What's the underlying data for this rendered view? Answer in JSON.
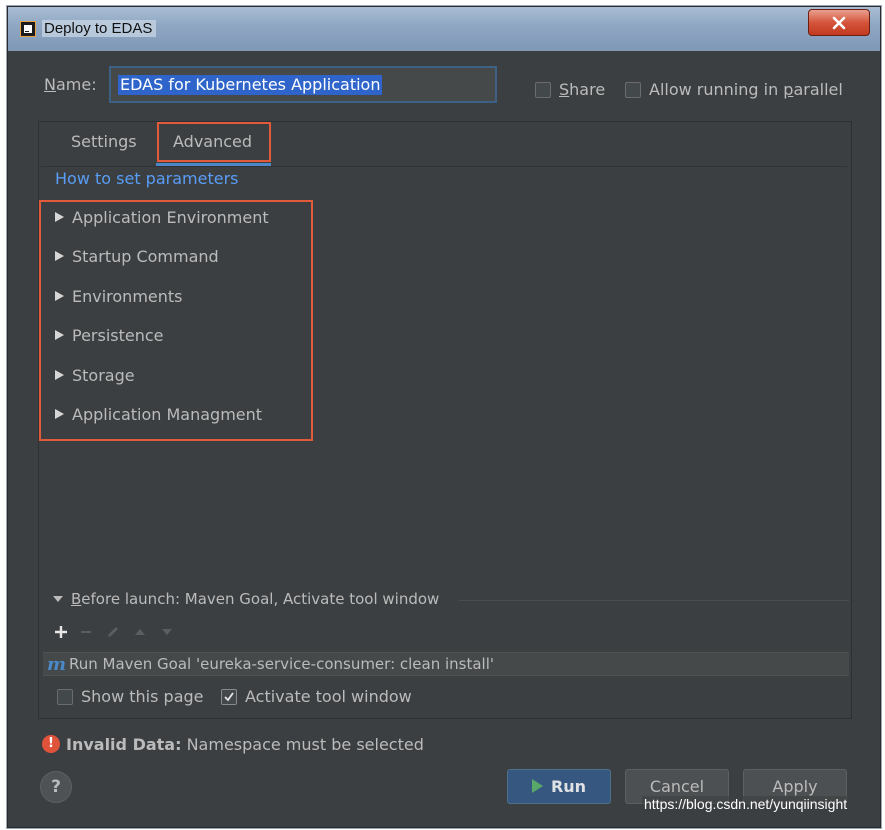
{
  "window": {
    "title": "Deploy to EDAS"
  },
  "form": {
    "name_label_mnemonic": "N",
    "name_label_rest": "ame:",
    "name_value": "EDAS for Kubernetes Application",
    "share_mnemonic": "S",
    "share_rest": "hare",
    "share_checked": false,
    "parallel_prefix": "Allow running in ",
    "parallel_mnemonic": "p",
    "parallel_rest": "arallel",
    "parallel_checked": false
  },
  "tabs": [
    {
      "label": "Settings",
      "active": false
    },
    {
      "label": "Advanced",
      "active": true
    }
  ],
  "help_link": "How to set parameters",
  "sections": [
    "Application Environment",
    "Startup Command",
    "Environments",
    "Persistence",
    "Storage",
    "Application Managment"
  ],
  "before_launch": {
    "mnemonic": "B",
    "rest": "efore launch: Maven Goal, Activate tool window",
    "toolbar_icons": [
      "add-icon",
      "remove-icon",
      "edit-icon",
      "move-up-icon",
      "move-down-icon"
    ],
    "tasks": [
      {
        "icon": "maven-icon",
        "icon_glyph": "m",
        "label": "Run Maven Goal 'eureka-service-consumer: clean install'"
      }
    ],
    "show_page_label": "Show this page",
    "show_page_checked": false,
    "activate_label": "Activate tool window",
    "activate_checked": true
  },
  "warning": {
    "icon": "error-icon",
    "icon_glyph": "!",
    "bold": "Invalid Data:",
    "message": "Namespace must be selected"
  },
  "buttons": {
    "help": "?",
    "run": "Run",
    "cancel": "Cancel",
    "apply": "Apply"
  },
  "watermark": "https://blog.csdn.net/yunqiinsight",
  "colors": {
    "background": "#3c3f41",
    "accent": "#4a88c7",
    "link": "#589df6",
    "highlight": "#e15b3a",
    "selection": "#2f65ca"
  }
}
